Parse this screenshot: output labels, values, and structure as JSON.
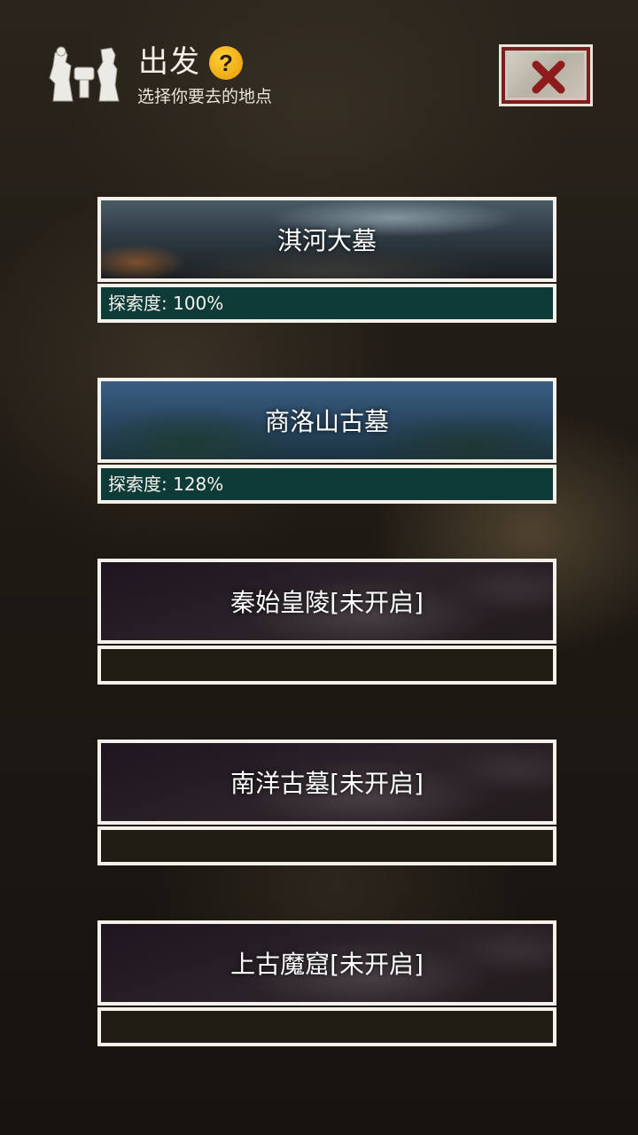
{
  "header": {
    "title": "出发",
    "help_symbol": "?",
    "subtitle": "选择你要去的地点",
    "logo_icon": "explorer-silhouette-icon",
    "close_icon": "close-x-icon"
  },
  "locations": [
    {
      "name": "淇河大墓",
      "progress": "探索度: 100%",
      "theme": "river"
    },
    {
      "name": "商洛山古墓",
      "progress": "探索度: 128%",
      "theme": "mountain"
    },
    {
      "name": "秦始皇陵[未开启]",
      "progress": "",
      "theme": "space"
    },
    {
      "name": "南洋古墓[未开启]",
      "progress": "",
      "theme": "space"
    },
    {
      "name": "上古魔窟[未开启]",
      "progress": "",
      "theme": "space"
    }
  ],
  "colors": {
    "progress_bar": "#0e3b38",
    "locked_bar": "#221d14",
    "close_accent": "#7a1f1f",
    "help_badge": "#f0a800"
  }
}
